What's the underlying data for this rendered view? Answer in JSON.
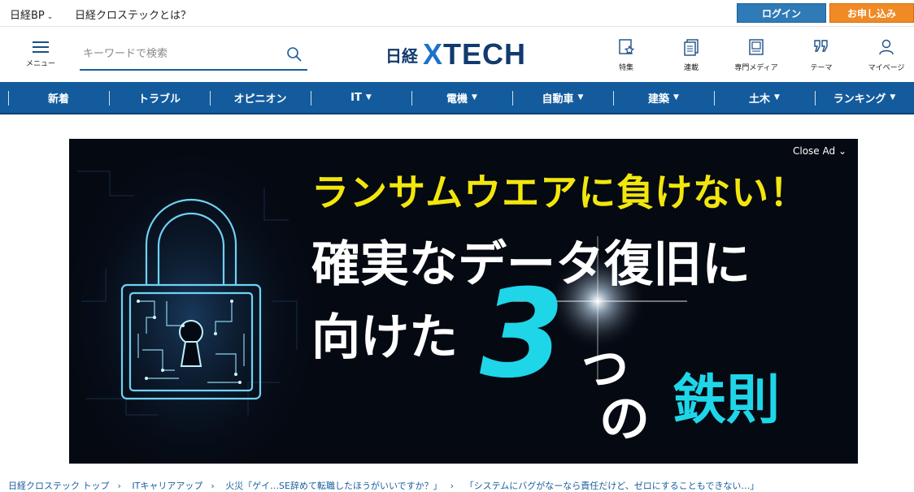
{
  "topbar": {
    "brand": "日経BP",
    "about": "日経クロステックとは？",
    "login": "ログイン",
    "apply": "お申し込み"
  },
  "header": {
    "menu_label": "メニュー",
    "search_placeholder": "キーワードで検索",
    "logo_nikkei": "日経",
    "logo_x": "X",
    "logo_tech": "TECH",
    "nav": [
      {
        "label": "特集",
        "icon": "star-document-icon"
      },
      {
        "label": "連載",
        "icon": "stacked-documents-icon"
      },
      {
        "label": "専門メディア",
        "icon": "magazine-icon"
      },
      {
        "label": "テーマ",
        "icon": "quote-marks-icon"
      },
      {
        "label": "マイページ",
        "icon": "user-icon"
      }
    ]
  },
  "catnav": [
    {
      "label": "新着",
      "dropdown": false
    },
    {
      "label": "トラブル",
      "dropdown": false
    },
    {
      "label": "オピニオン",
      "dropdown": false
    },
    {
      "label": "IT",
      "dropdown": true
    },
    {
      "label": "電機",
      "dropdown": true
    },
    {
      "label": "自動車",
      "dropdown": true
    },
    {
      "label": "建築",
      "dropdown": true
    },
    {
      "label": "土木",
      "dropdown": true
    },
    {
      "label": "ランキング",
      "dropdown": true
    }
  ],
  "ad": {
    "close_label": "Close Ad",
    "line1": "ランサムウエアに負けない！",
    "line2": "確実なデータ復旧に",
    "line3": "向けた",
    "number": "3",
    "tsu": "つ",
    "no": "の",
    "tessoku": "鉄則"
  },
  "breadcrumb": [
    "日経クロステック トップ",
    "ITキャリアアップ",
    "火災「ゲイ…SE辞めて転職したほうがいいですか？」",
    "「システムにバグがなーなら責任だけど、ゼロにすることもできない…」"
  ],
  "colors": {
    "brand_blue": "#135b9c",
    "login_blue": "#2e7bb8",
    "apply_orange": "#f08a24",
    "ad_yellow": "#f2e60c",
    "ad_cyan": "#1ed6e8"
  }
}
